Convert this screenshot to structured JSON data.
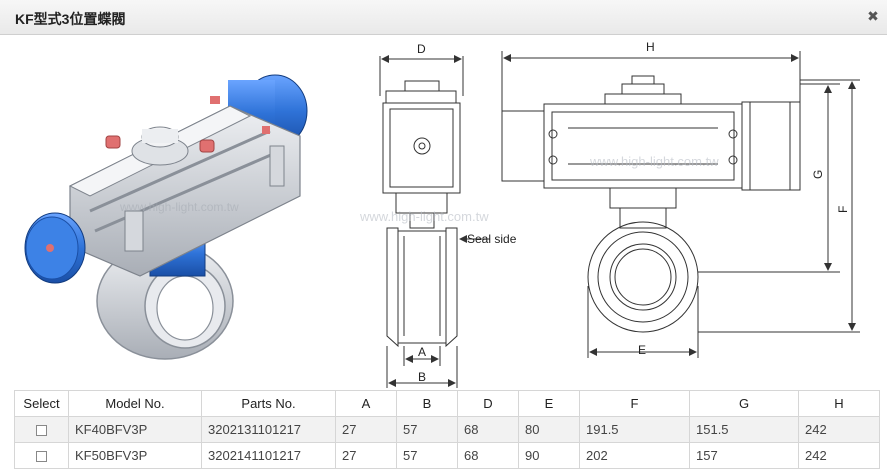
{
  "window": {
    "title": "KF型式3位置蝶閥",
    "close_icon": "close-icon",
    "close_glyph": "✖"
  },
  "drawing": {
    "dimension_labels": {
      "D": "D",
      "H": "H",
      "G": "G",
      "F": "F",
      "E": "E",
      "A": "A",
      "B": "B"
    },
    "seal_side_label": "Seal side",
    "watermark_text": "www.high-light.com.tw",
    "colors": {
      "actuator_blue": "#2f73d8",
      "body_gray": "#c9cdd4",
      "line": "#333333",
      "accent_red": "#e07070"
    }
  },
  "table": {
    "columns": [
      "Select",
      "Model No.",
      "Parts No.",
      "A",
      "B",
      "D",
      "E",
      "F",
      "G",
      "H"
    ],
    "rows": [
      {
        "model": "KF40BFV3P",
        "parts": "3202131101217",
        "A": "27",
        "B": "57",
        "D": "68",
        "E": "80",
        "F": "191.5",
        "G": "151.5",
        "H": "242"
      },
      {
        "model": "KF50BFV3P",
        "parts": "3202141101217",
        "A": "27",
        "B": "57",
        "D": "68",
        "E": "90",
        "F": "202",
        "G": "157",
        "H": "242"
      }
    ]
  }
}
